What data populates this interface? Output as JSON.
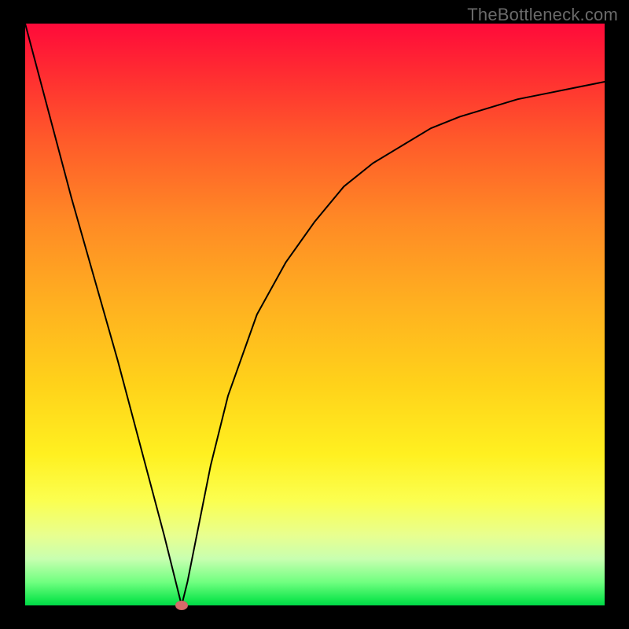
{
  "watermark": "TheBottleneck.com",
  "marker": {
    "x_fraction": 0.27
  },
  "chart_data": {
    "type": "line",
    "title": "",
    "xlabel": "",
    "ylabel": "",
    "xlim": [
      0,
      100
    ],
    "ylim": [
      0,
      100
    ],
    "series": [
      {
        "name": "curve",
        "x": [
          0,
          4,
          8,
          12,
          16,
          20,
          24,
          26,
          27,
          28,
          30,
          32,
          35,
          40,
          45,
          50,
          55,
          60,
          65,
          70,
          75,
          80,
          85,
          90,
          95,
          100
        ],
        "y": [
          100,
          85,
          70,
          56,
          42,
          27,
          12,
          4,
          0,
          4,
          14,
          24,
          36,
          50,
          59,
          66,
          72,
          76,
          79,
          82,
          84,
          85.5,
          87,
          88,
          89,
          90
        ]
      }
    ],
    "marker_point": {
      "series": "curve",
      "x": 27,
      "y": 0
    }
  }
}
